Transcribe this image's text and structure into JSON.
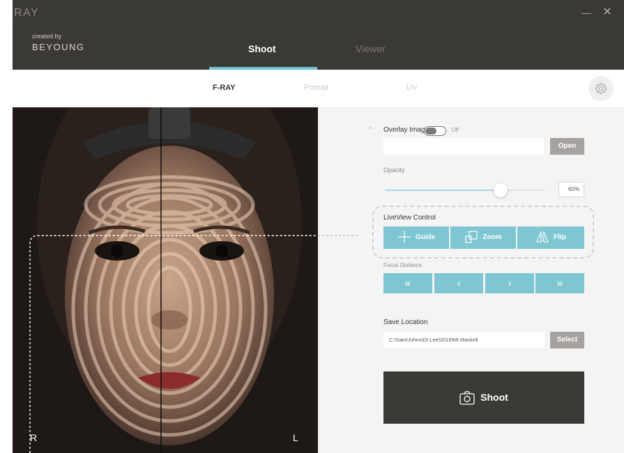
{
  "window": {
    "title": "F-RAY",
    "created_by": "created by",
    "brand": "BEYOUNG",
    "min_glyph": "—",
    "close_glyph": "✕"
  },
  "tabs": {
    "shoot": "Shoot",
    "viewer": "Viewer",
    "active": "Shoot"
  },
  "subtabs": {
    "fray": "F-RAY",
    "portrait": "Portrait",
    "uv": "UV",
    "active": "F-RAY"
  },
  "icons": {
    "settings": "gear-icon",
    "guide": "crosshair-icon",
    "zoom": "zoom-squares-icon",
    "flip": "flip-icon",
    "camera": "camera-icon"
  },
  "liveview": {
    "label_right": "R",
    "label_left": "L"
  },
  "overlay": {
    "label": "Overlay Image",
    "toggle_state": "Off",
    "path_value": "",
    "open_label": "Open"
  },
  "opacity": {
    "label": "Opacity",
    "value": 60,
    "value_text": "60%"
  },
  "liveview_control": {
    "label": "LiveView Control",
    "guide_label": "Guide",
    "zoom_label": "Zoom",
    "flip_label": "Flip"
  },
  "focus": {
    "label": "Focus Distance",
    "far_back": "«",
    "back": "‹",
    "fwd": "›",
    "far_fwd": "»"
  },
  "save": {
    "label": "Save Location",
    "path": "C:\\SaintJohns\\Dr.Lee\\2016\\Mr.Maskell",
    "select_label": "Select"
  },
  "shoot": {
    "label": "Shoot"
  },
  "colors": {
    "dark": "#3b3936",
    "accent": "#7ec6d2",
    "tab_indicator": "#6fc3cf",
    "gray_button": "#a5a2a0"
  }
}
